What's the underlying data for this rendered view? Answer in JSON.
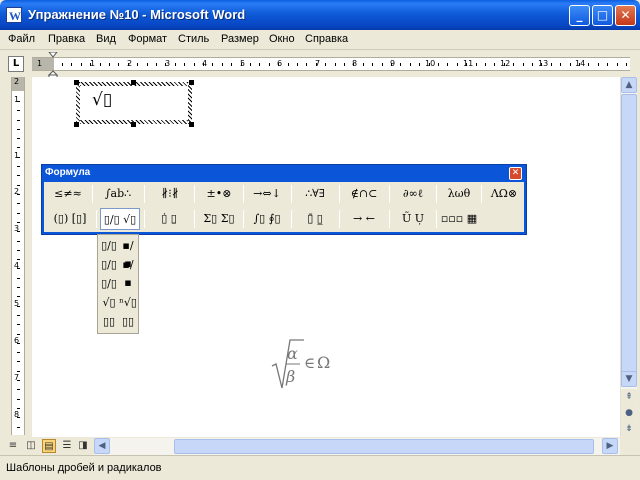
{
  "window": {
    "title": "Упражнение №10 - Microsoft Word",
    "app_icon": "word-icon",
    "controls": [
      "minimize",
      "maximize",
      "close"
    ]
  },
  "menu": [
    "Файл",
    "Правка",
    "Вид",
    "Формат",
    "Стиль",
    "Размер",
    "Окно",
    "Справка"
  ],
  "ruler": {
    "tab_selector": "L",
    "h_numbers": [
      "1",
      "1",
      "2",
      "3",
      "4",
      "5",
      "6",
      "7",
      "8",
      "9",
      "10",
      "11",
      "12",
      "13",
      "14"
    ],
    "v_numbers": [
      "1",
      "2",
      "1",
      "2",
      "3",
      "4",
      "5",
      "6",
      "7",
      "8",
      "9",
      "10"
    ]
  },
  "equation_editor": {
    "inline_box_content": "√▯",
    "formula_toolbar": {
      "title": "Формула",
      "row1": [
        "≤≠≈",
        "∫ab∴",
        "∦⁝∦",
        "±•⊗",
        "→⇔↓",
        "∴∀∃",
        "∉∩⊂",
        "∂∞ℓ",
        "λωθ",
        "ΛΩ⊗"
      ],
      "row2": [
        "(▯) [▯]",
        "▯/▯ √▯",
        "▯̇ ▯̱",
        "Σ▯ Σ▯",
        "∫▯ ∮▯",
        "▯̄ ▯̲",
        "→ ←",
        "Ũ Ụ",
        "▫▫▫ ▦"
      ]
    },
    "palette_title": "Шаблоны дробей и радикалов",
    "palette_items": [
      "▯/▯",
      "▪/▪",
      "▯/▯",
      "▪/▪",
      "▯/▯",
      "",
      "√▯",
      "ⁿ√▯",
      "▯▯",
      "▯▯"
    ]
  },
  "document": {
    "formula": {
      "numerator": "α",
      "denominator": "β",
      "relation": "∈",
      "set": "Ω"
    }
  },
  "status": {
    "text": "Шаблоны дробей и радикалов"
  },
  "colors": {
    "titlebar": "#0a55d8",
    "window_bg": "#ece9d8",
    "formula_gray": "#777777"
  }
}
